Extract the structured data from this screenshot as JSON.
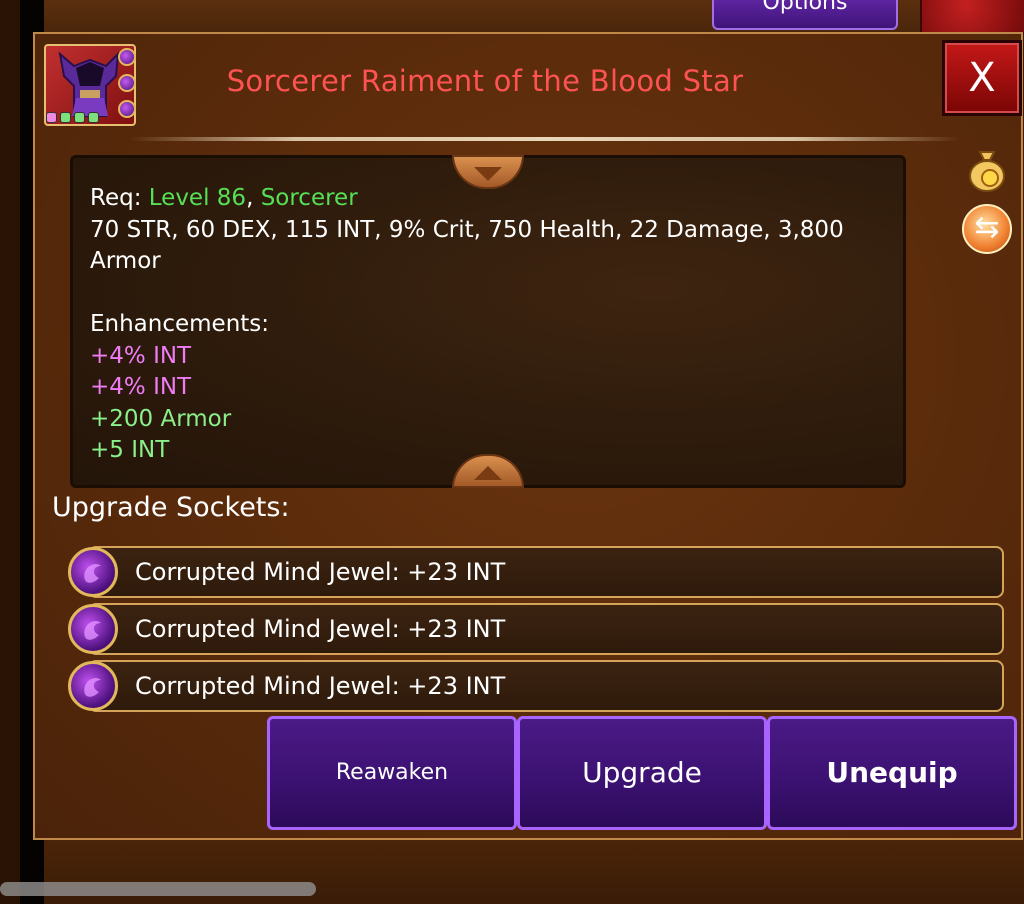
{
  "header": {
    "options_label": "Options",
    "title": "Sorcerer Raiment of the Blood Star",
    "close_label": "X"
  },
  "item_icon": {
    "gem_count": 3,
    "pips": [
      "#f08ae0",
      "#7de07d",
      "#7de07d",
      "#7de07d"
    ]
  },
  "side_icons": [
    "money-bag-icon",
    "swap-arrows-icon"
  ],
  "stats": {
    "req_label": "Req:",
    "level": "Level 86",
    "separator": ",",
    "class": "Sorcerer",
    "line1": "70 STR, 60 DEX, 115 INT, 9% Crit, 750 Health, 22 Damage, 3,800",
    "line2": "Armor",
    "enhancements_label": "Enhancements:",
    "enhancements": [
      {
        "text": "+4% INT",
        "color": "pink"
      },
      {
        "text": "+4% INT",
        "color": "pink"
      },
      {
        "text": "+200 Armor",
        "color": "light-green"
      },
      {
        "text": "+5 INT",
        "color": "light-green"
      }
    ]
  },
  "sockets": {
    "label": "Upgrade Sockets:",
    "items": [
      {
        "text": "Corrupted Mind Jewel: +23 INT"
      },
      {
        "text": "Corrupted Mind Jewel: +23 INT"
      },
      {
        "text": "Corrupted Mind Jewel: +23 INT"
      }
    ]
  },
  "actions": {
    "reawaken": "Reawaken",
    "upgrade": "Upgrade",
    "unequip": "Unequip"
  },
  "colors": {
    "title": "#ff5252",
    "green": "#55e055",
    "enh_pink": "#f07cf4",
    "enh_green": "#8af08a",
    "button": "#3a1170",
    "button_border": "#a864ff",
    "close": "#c51818"
  }
}
